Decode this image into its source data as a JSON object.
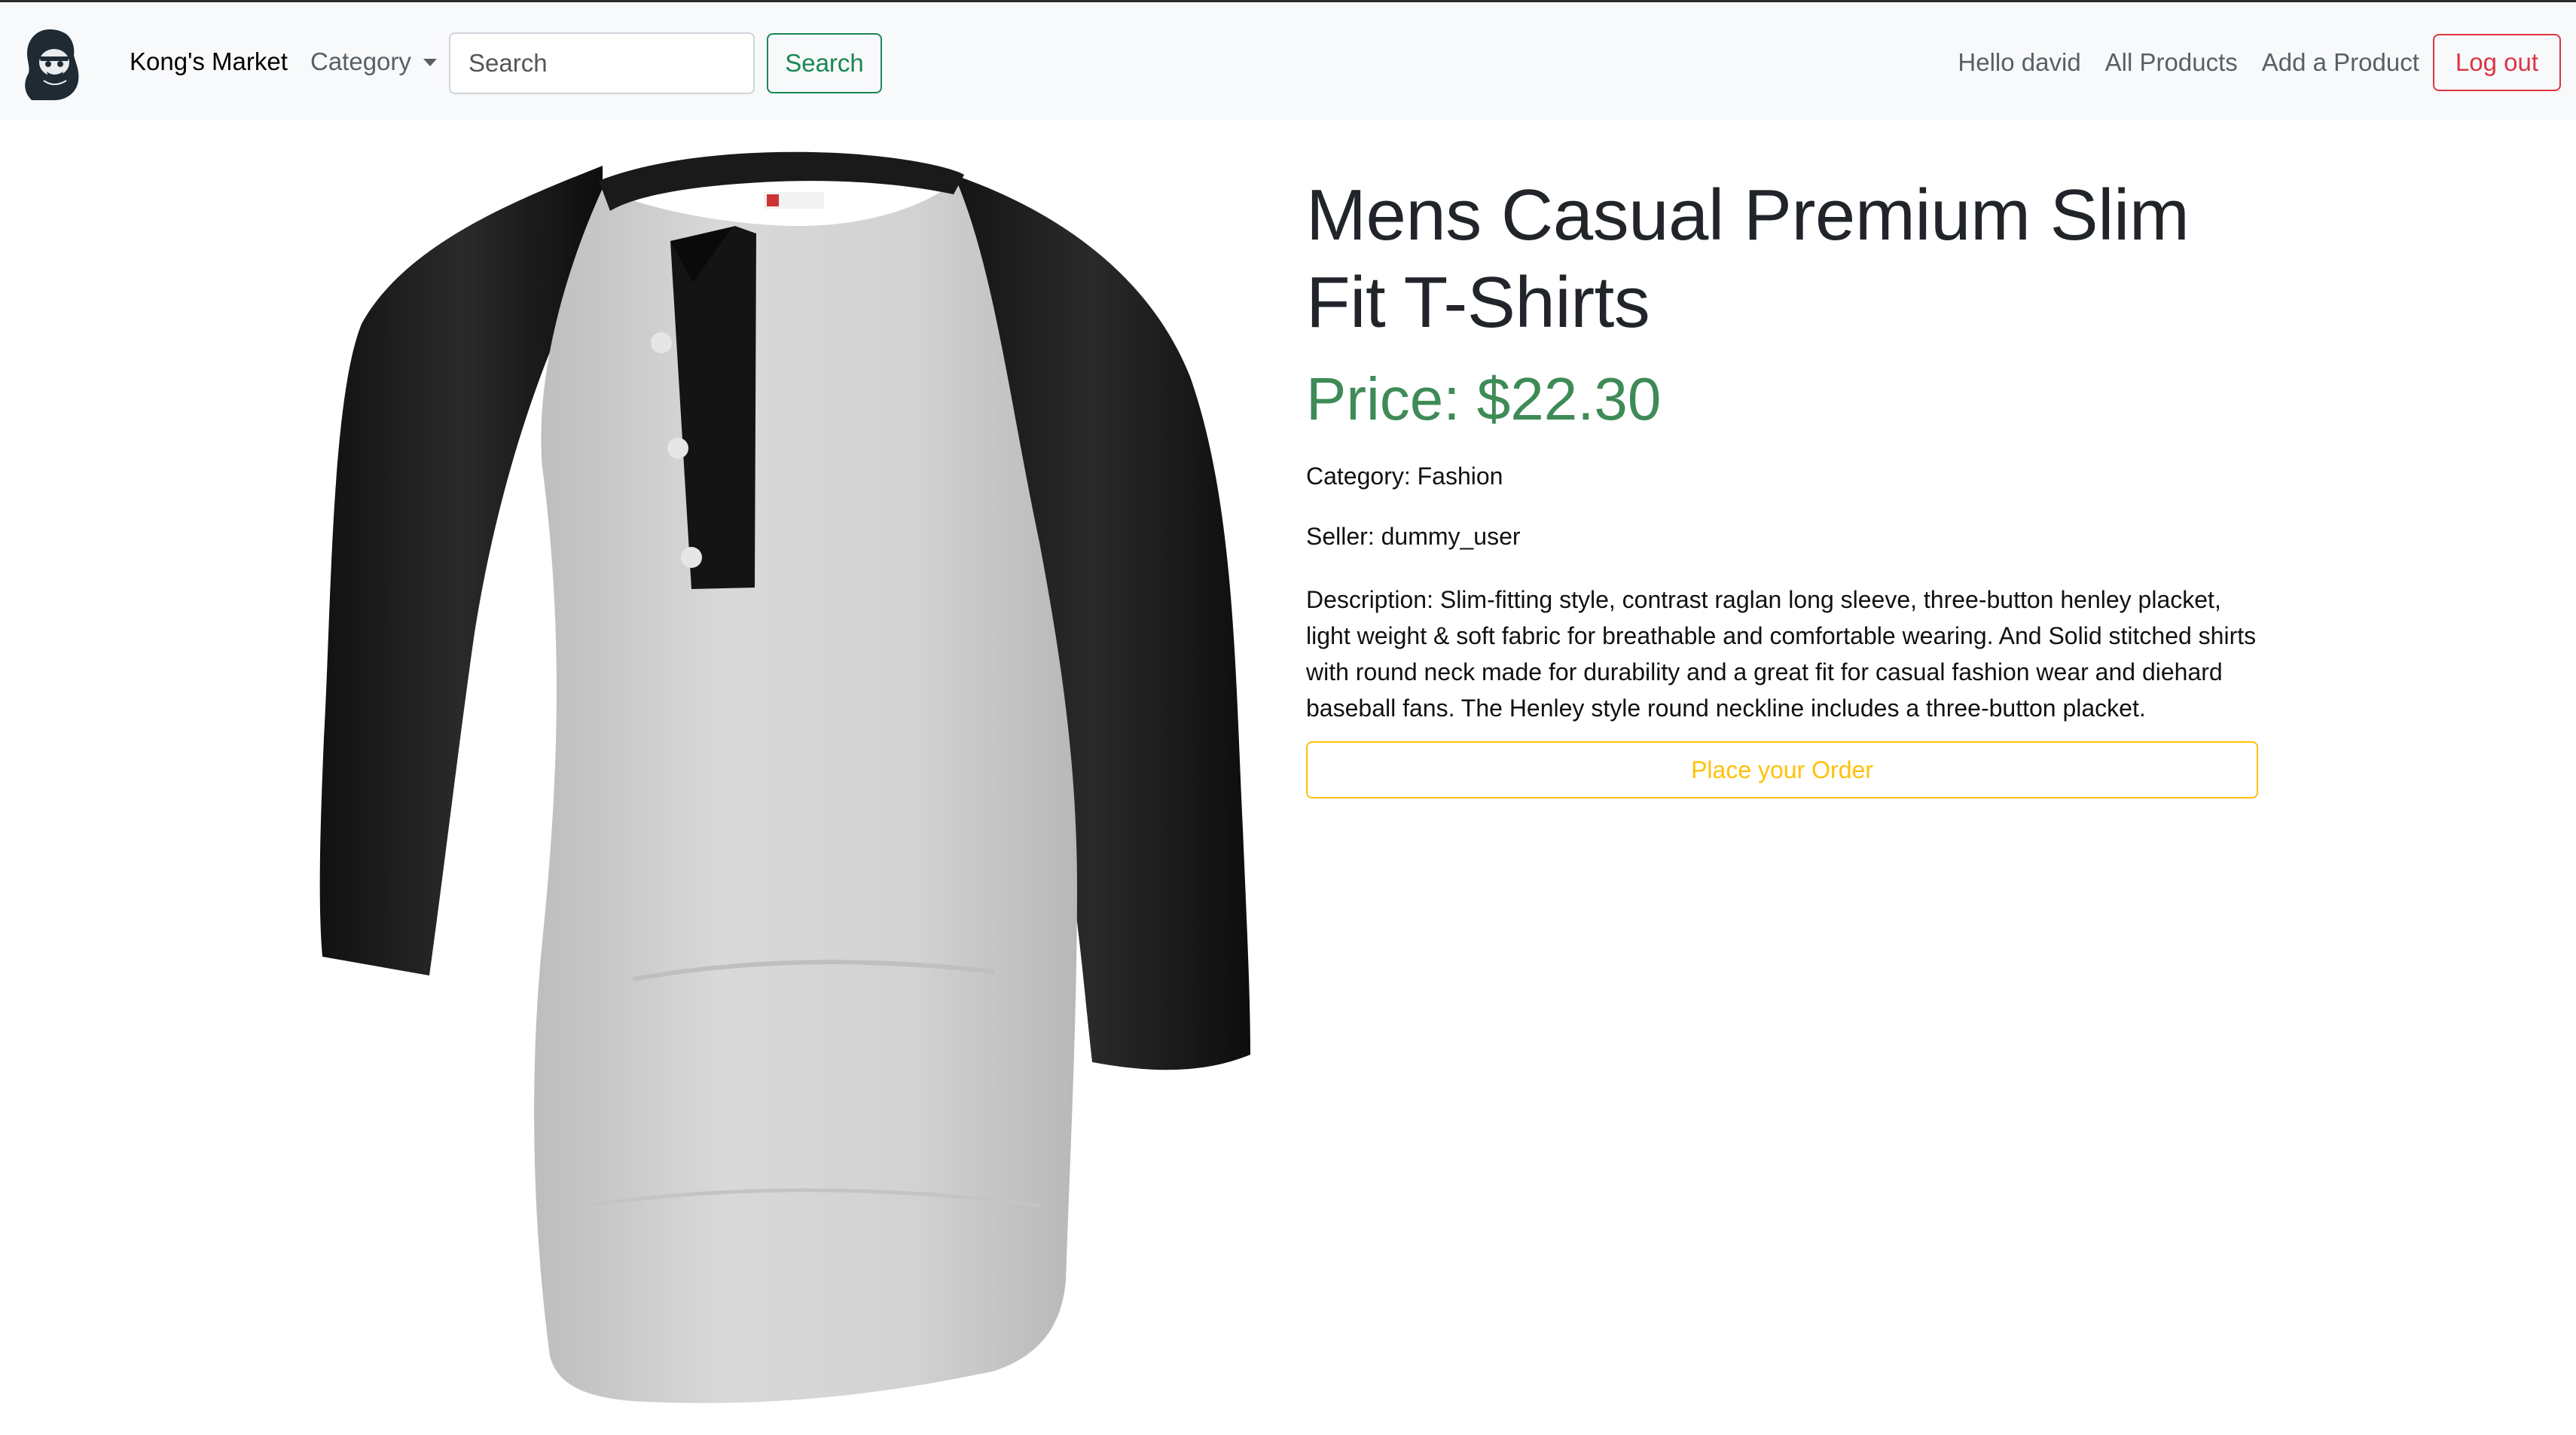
{
  "navbar": {
    "brand_name": "Kong's Market",
    "category_label": "Category",
    "search_placeholder": "Search",
    "search_button_label": "Search",
    "greeting": "Hello david",
    "all_products_label": "All Products",
    "add_product_label": "Add a Product",
    "logout_label": "Log out",
    "logo_icon": "gorilla-logo-icon"
  },
  "product": {
    "title": "Mens Casual Premium Slim Fit T-Shirts",
    "price": "Price: $22.30",
    "category": "Category: Fashion",
    "seller": "Seller: dummy_user",
    "description": "Description: Slim-fitting style, contrast raglan long sleeve, three-button henley placket, light weight & soft fabric for breathable and comfortable wearing. And Solid stitched shirts with round neck made for durability and a great fit for casual fashion wear and diehard baseball fans. The Henley style round neckline includes a three-button placket.",
    "order_button_label": "Place your Order",
    "image": "product-image-raglan-henley-shirt"
  },
  "colors": {
    "success": "#198754",
    "price": "#3e8b57",
    "danger": "#dc3545",
    "warning": "#ffc107",
    "navbar_bg": "#f8f9fa"
  }
}
